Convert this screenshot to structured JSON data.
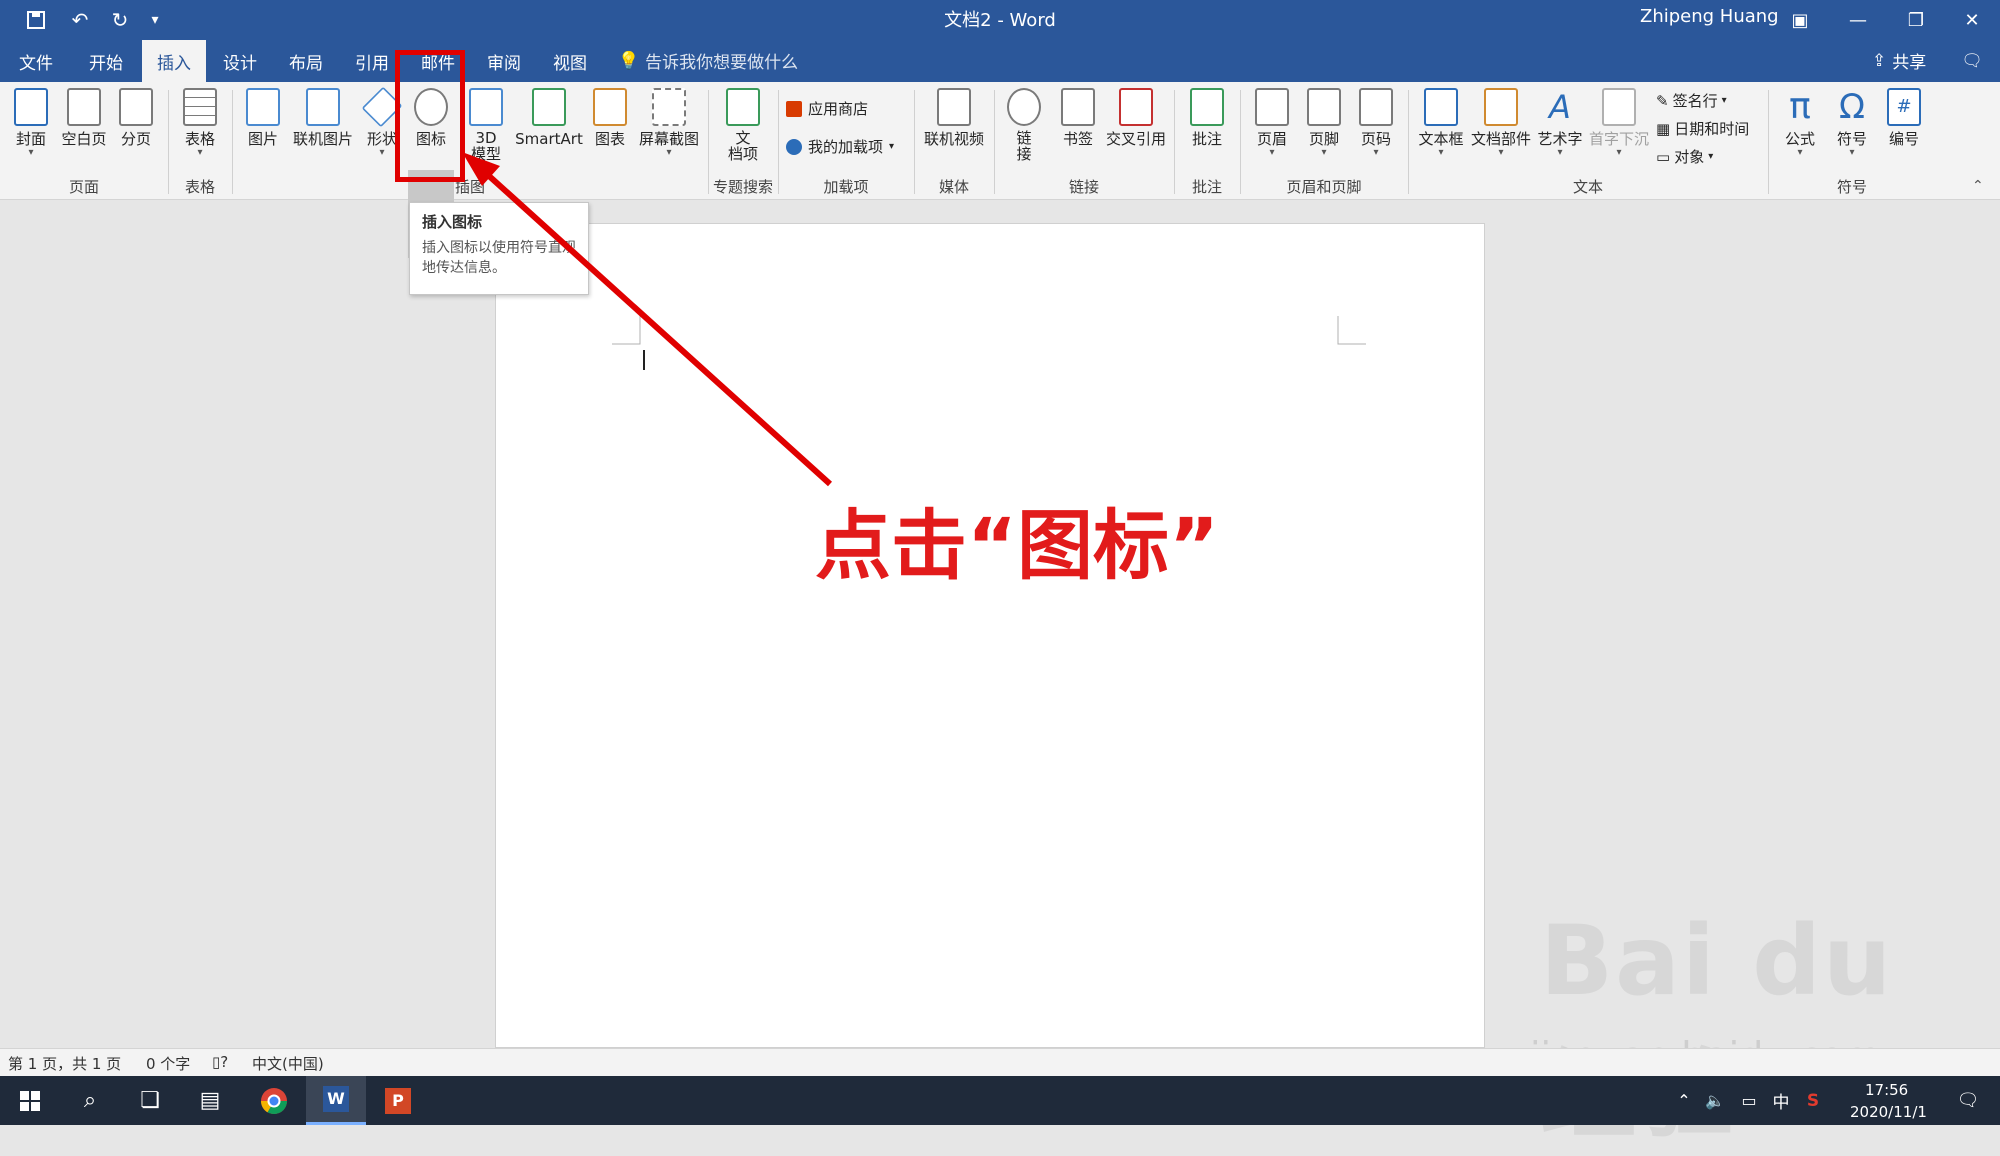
{
  "titlebar": {
    "doc_title": "文档2 - Word",
    "user": "Zhipeng Huang",
    "qat": [
      "save-icon",
      "undo-icon",
      "redo-icon",
      "customize-icon"
    ]
  },
  "tabs": [
    "文件",
    "开始",
    "插入",
    "设计",
    "布局",
    "引用",
    "邮件",
    "审阅",
    "视图"
  ],
  "active_tab": "插入",
  "tellme": "告诉我你想要做什么",
  "share": "共享",
  "ribbon": {
    "buttons": {
      "cover": "封面",
      "blank_page": "空白页",
      "page_break": "分页",
      "table": "表格",
      "picture": "图片",
      "online_picture": "联机图片",
      "shapes": "形状",
      "icons": "图标",
      "model_3d": "3D\n模型",
      "smartart": "SmartArt",
      "chart": "图表",
      "screenshot": "屏幕截图",
      "doc_search": "文\n档项",
      "store": "应用商店",
      "my_addins": "我的加载项",
      "online_video": "联机视频",
      "link": "链\n接",
      "bookmark": "书签",
      "cross_ref": "交叉引用",
      "comment": "批注",
      "header": "页眉",
      "footer": "页脚",
      "page_number": "页码",
      "textbox": "文本框",
      "doc_parts": "文档部件",
      "wordart": "艺术字",
      "dropcap": "首字下沉",
      "signature": "签名行",
      "datetime": "日期和时间",
      "object": "对象",
      "equation": "公式",
      "symbol": "符号",
      "number": "编号"
    },
    "groups": {
      "pages": "页面",
      "tables": "表格",
      "illustrations": "插图",
      "topic_search": "专题搜索",
      "addins": "加载项",
      "media": "媒体",
      "links": "链接",
      "comments": "批注",
      "header_footer": "页眉和页脚",
      "text": "文本",
      "symbols": "符号"
    }
  },
  "tooltip": {
    "title": "插入图标",
    "desc": "插入图标以使用符号直观地传达信息。"
  },
  "callout": "点击“图标”",
  "statusbar": {
    "page": "第 1 页，共 1 页",
    "words": "0 个字",
    "lang": "中文(中国)"
  },
  "taskbar": {
    "ime": "中",
    "time": "17:56",
    "date": "2020/11/1"
  },
  "watermark": "Bai du 经验",
  "watermark_url": "jingyan.baidu.com"
}
